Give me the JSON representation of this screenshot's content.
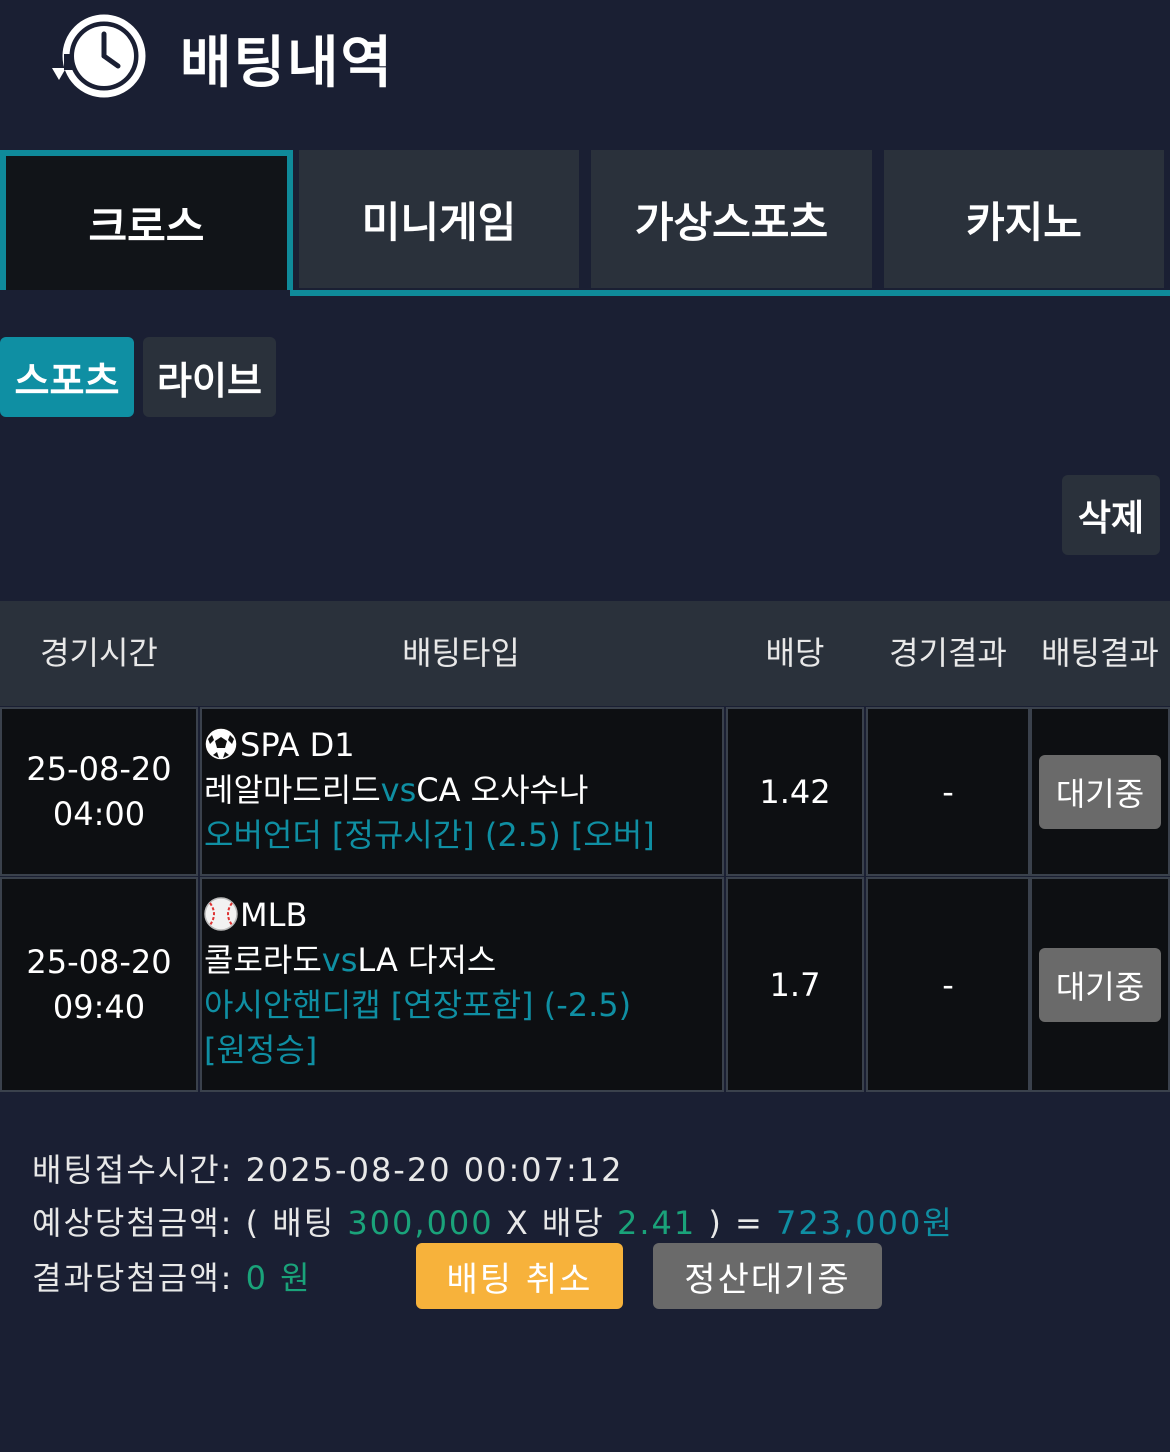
{
  "header": {
    "title": "배팅내역",
    "icon": "history-clock-icon"
  },
  "tabs": [
    {
      "label": "크로스",
      "active": true
    },
    {
      "label": "미니게임",
      "active": false
    },
    {
      "label": "가상스포츠",
      "active": false
    },
    {
      "label": "카지노",
      "active": false
    }
  ],
  "subtabs": [
    {
      "label": "스포츠",
      "active": true
    },
    {
      "label": "라이브",
      "active": false
    }
  ],
  "delete_label": "삭제",
  "table": {
    "headers": [
      "경기시간",
      "배팅타입",
      "배당",
      "경기결과",
      "배팅결과"
    ],
    "rows": [
      {
        "date": "25-08-20",
        "time": "04:00",
        "sport_icon": "soccer-ball-icon",
        "league": "SPA D1",
        "home": "레알마드리드",
        "vs": "vs",
        "away": "CA 오사수나",
        "bet_type": "오버언더 [정규시간] (2.5) [오버]",
        "odds": "1.42",
        "result": "-",
        "status": "대기중"
      },
      {
        "date": "25-08-20",
        "time": "09:40",
        "sport_icon": "baseball-icon",
        "league": "MLB",
        "home": "콜로라도",
        "vs": "vs",
        "away": "LA 다저스",
        "bet_type_line1": "아시안핸디캡 [연장포함] (-2.5)",
        "bet_type_line2": "[원정승]",
        "odds": "1.7",
        "result": "-",
        "status": "대기중"
      }
    ]
  },
  "summary": {
    "receipt_label": "배팅접수시간:",
    "receipt_time": "2025-08-20 00:07:12",
    "expected_label": "예상당첨금액:",
    "open_paren": "(",
    "bet_label": "배팅",
    "bet_amount": "300,000",
    "times": "X",
    "odds_label": "배당",
    "total_odds": "2.41",
    "close_paren_eq": ") =",
    "expected_amount": "723,000원",
    "result_label": "결과당첨금액:",
    "result_amount": "0",
    "result_unit": "원"
  },
  "buttons": {
    "cancel": "배팅 취소",
    "pending": "정산대기중"
  },
  "colors": {
    "accent": "#0f8fa3",
    "cancel": "#f7b23b",
    "pending": "#6a6a6a",
    "bg": "#1a1f33"
  }
}
